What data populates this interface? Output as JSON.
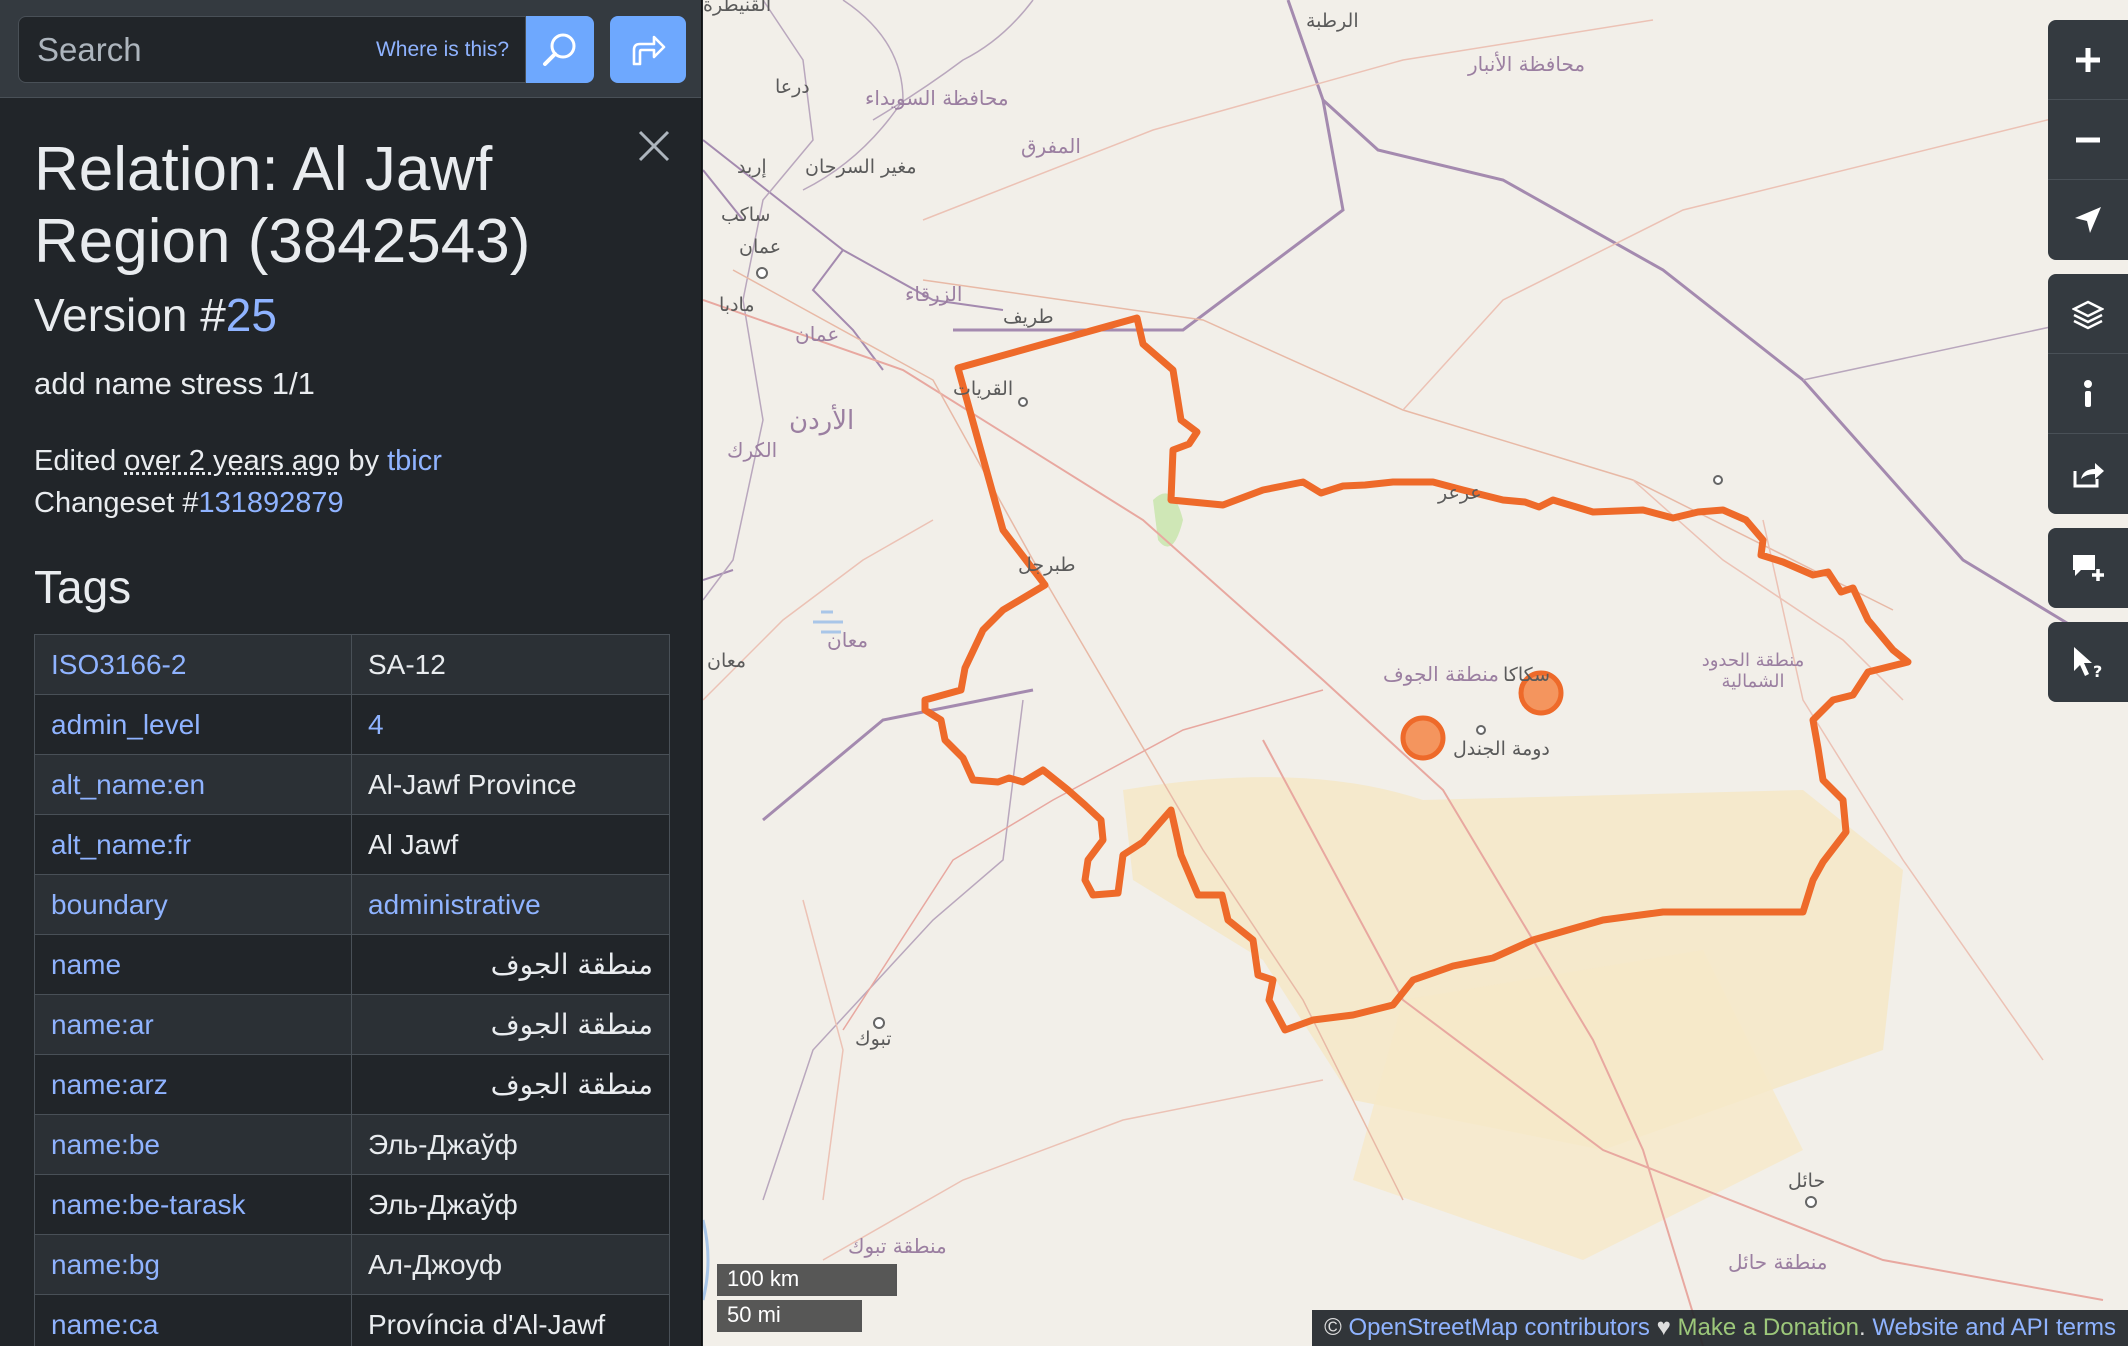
{
  "search": {
    "placeholder": "Search",
    "where_label": "Where is this?"
  },
  "feature": {
    "title": "Relation: Al Jawf Region (3842543)",
    "version_prefix": "Version #",
    "version_number": "25",
    "comment": "add name stress 1/1",
    "edited_prefix": "Edited",
    "edited_ago": "over 2 years ago",
    "edited_by": "by",
    "user": "tbicr",
    "changeset_prefix": "Changeset #",
    "changeset_number": "131892879"
  },
  "tags": {
    "heading": "Tags",
    "rows": [
      {
        "key": "ISO3166-2",
        "value": "SA-12",
        "value_link": false,
        "rtl": false
      },
      {
        "key": "admin_level",
        "value": "4",
        "value_link": true,
        "rtl": false
      },
      {
        "key": "alt_name:en",
        "value": "Al-Jawf Province",
        "value_link": false,
        "rtl": false
      },
      {
        "key": "alt_name:fr",
        "value": "Al Jawf",
        "value_link": false,
        "rtl": false
      },
      {
        "key": "boundary",
        "value": "administrative",
        "value_link": true,
        "rtl": false
      },
      {
        "key": "name",
        "value": "منطقة الجوف",
        "value_link": false,
        "rtl": true
      },
      {
        "key": "name:ar",
        "value": "منطقة الجوف",
        "value_link": false,
        "rtl": true
      },
      {
        "key": "name:arz",
        "value": "منطقة الجوف",
        "value_link": false,
        "rtl": true
      },
      {
        "key": "name:be",
        "value": "Эль-Джаўф",
        "value_link": false,
        "rtl": false
      },
      {
        "key": "name:be-tarask",
        "value": "Эль-Джаўф",
        "value_link": false,
        "rtl": false
      },
      {
        "key": "name:bg",
        "value": "Ал-Джоуф",
        "value_link": false,
        "rtl": false
      },
      {
        "key": "name:ca",
        "value": "Província d'Al-Jawf",
        "value_link": false,
        "rtl": false
      }
    ]
  },
  "map": {
    "places": [
      {
        "name": "القنيطرة",
        "region": false
      },
      {
        "name": "الرطبة",
        "region": false
      },
      {
        "name": "محافظة الأنبار",
        "region": true
      },
      {
        "name": "درعا",
        "region": false
      },
      {
        "name": "محافظة السويداء",
        "region": true
      },
      {
        "name": "إربد",
        "region": false
      },
      {
        "name": "مغير السرحان",
        "region": false
      },
      {
        "name": "المفرق",
        "region": true
      },
      {
        "name": "ساكب",
        "region": false
      },
      {
        "name": "عمان",
        "region": false
      },
      {
        "name": "مادبا",
        "region": false
      },
      {
        "name": "الزرقاء",
        "region": true
      },
      {
        "name": "عمان",
        "region": true
      },
      {
        "name": "طريف",
        "region": false
      },
      {
        "name": "القريات",
        "region": false
      },
      {
        "name": "الأردن",
        "region": true
      },
      {
        "name": "الكرك",
        "region": true
      },
      {
        "name": "عرعر",
        "region": false
      },
      {
        "name": "طبرجل",
        "region": false
      },
      {
        "name": "معان",
        "region": true
      },
      {
        "name": "معان",
        "region": false
      },
      {
        "name": "منطقة الجوف",
        "region": true
      },
      {
        "name": "سكاكا",
        "region": false
      },
      {
        "name": "دومة الجندل",
        "region": false
      },
      {
        "name": "منطقة الحدود الشمالية",
        "region": true
      },
      {
        "name": "تبوك",
        "region": false
      },
      {
        "name": "حائل",
        "region": false
      },
      {
        "name": "منطقة تبوك",
        "region": true
      },
      {
        "name": "منطقة حائل",
        "region": true
      }
    ],
    "boundary_color": "#ee6a2a",
    "scale_km": "100 km",
    "scale_mi": "50 mi"
  },
  "controls": {
    "zoom_in": "zoom-in",
    "zoom_out": "zoom-out",
    "locate": "locate",
    "layers": "layers",
    "info": "info",
    "share": "share",
    "add_note": "add-note",
    "query": "query"
  },
  "attribution": {
    "copyright": "©",
    "osm": "OpenStreetMap contributors",
    "heart": "♥",
    "donate": "Make a Donation",
    "dot": ".",
    "terms": "Website and API terms"
  }
}
